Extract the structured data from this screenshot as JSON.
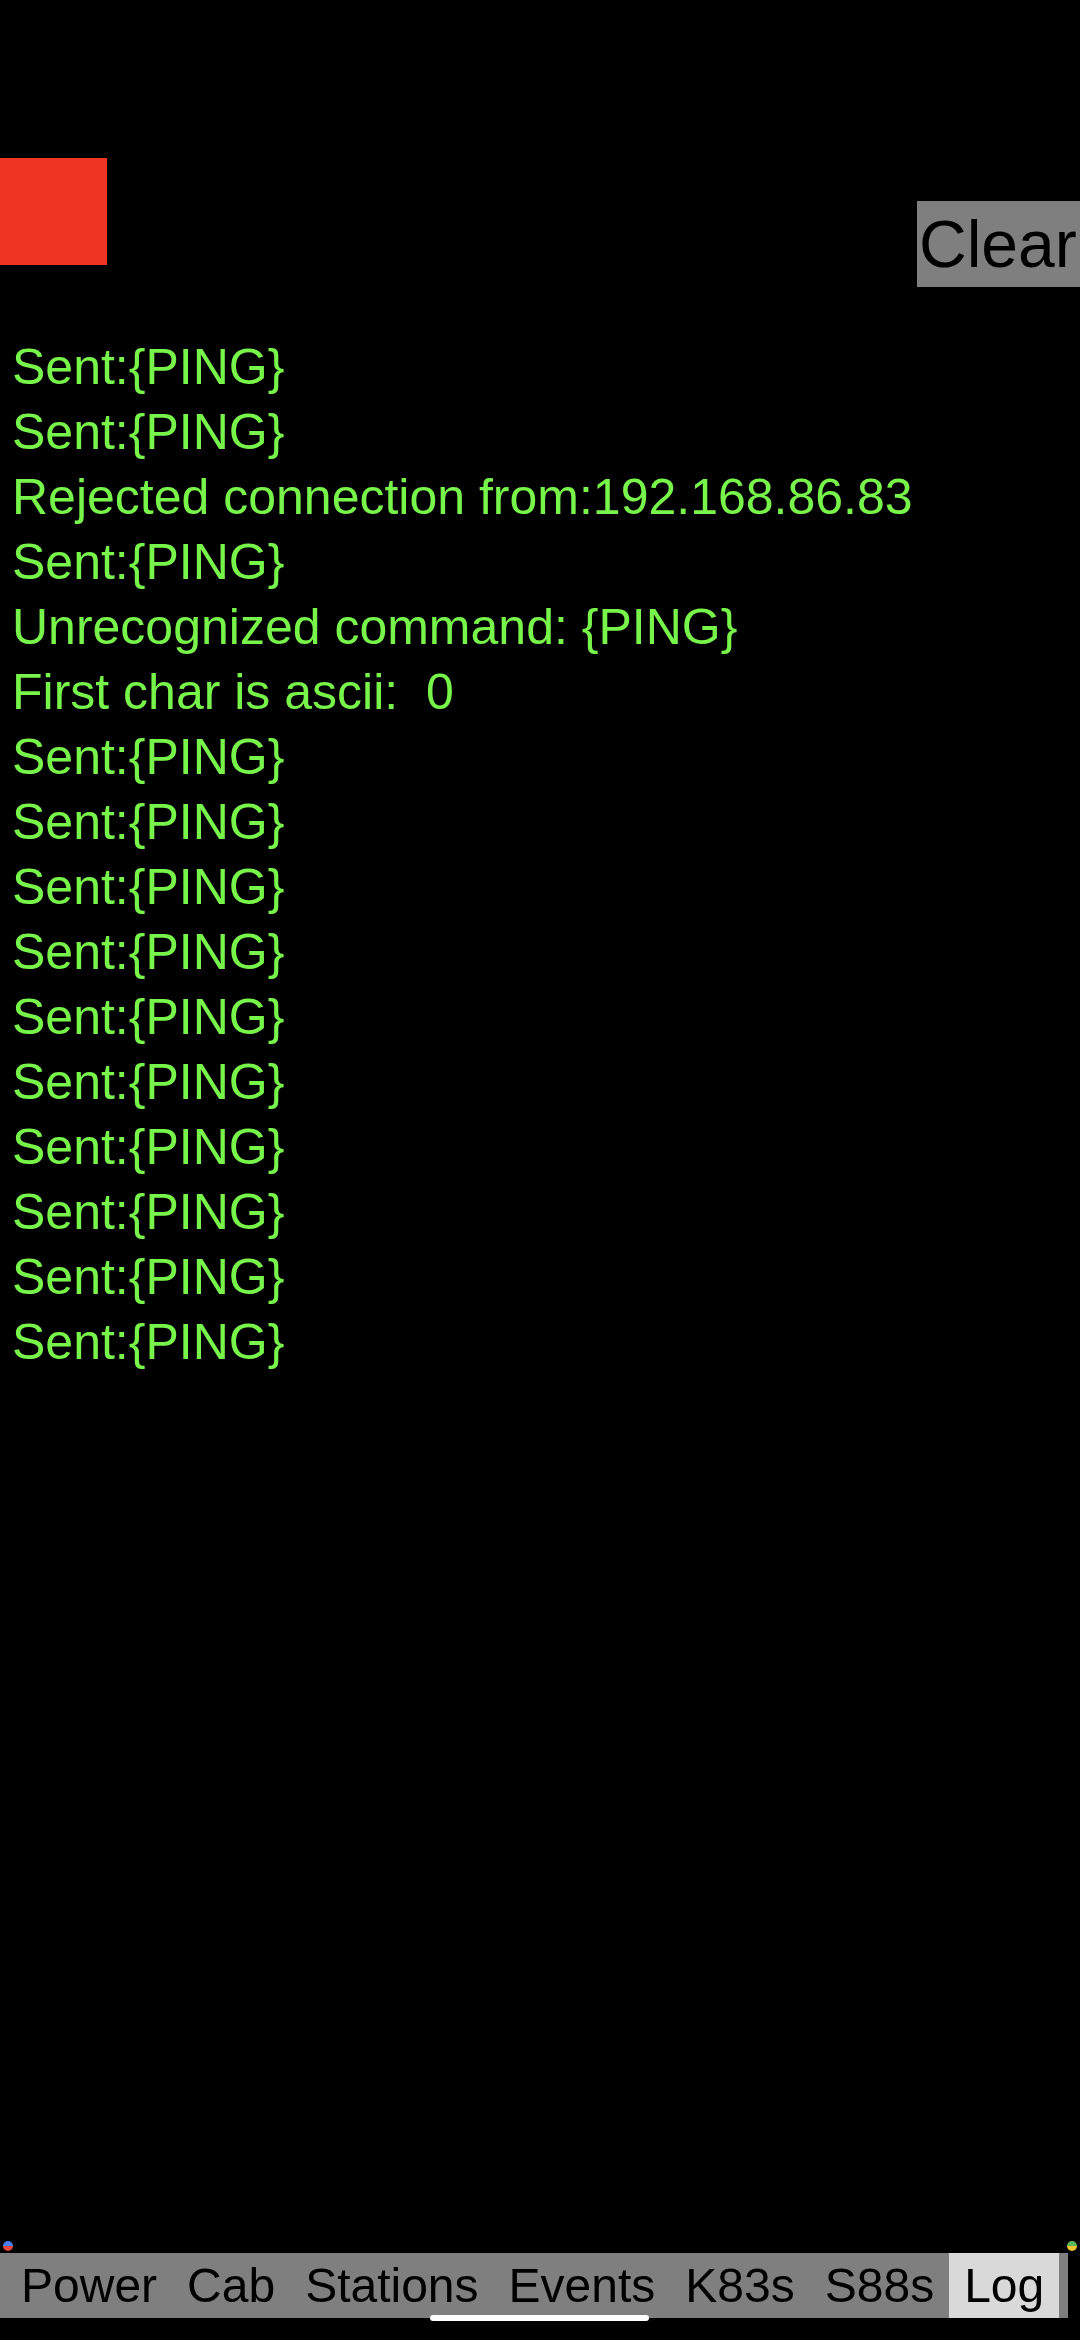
{
  "header": {
    "clear_button": "Clear"
  },
  "log": {
    "lines": [
      "Sent:{PING}",
      "Sent:{PING}",
      "Rejected connection from:192.168.86.83",
      "Sent:{PING}",
      "Unrecognized command: {PING}",
      "First char is ascii:  0",
      "Sent:{PING}",
      "Sent:{PING}",
      "Sent:{PING}",
      "Sent:{PING}",
      "Sent:{PING}",
      "Sent:{PING}",
      "Sent:{PING}",
      "Sent:{PING}",
      "Sent:{PING}",
      "Sent:{PING}"
    ]
  },
  "tabs": [
    {
      "label": "Power",
      "selected": false
    },
    {
      "label": "Cab",
      "selected": false
    },
    {
      "label": "Stations",
      "selected": false
    },
    {
      "label": "Events",
      "selected": false
    },
    {
      "label": "K83s",
      "selected": false
    },
    {
      "label": "S88s",
      "selected": false
    },
    {
      "label": "Log",
      "selected": true
    }
  ]
}
